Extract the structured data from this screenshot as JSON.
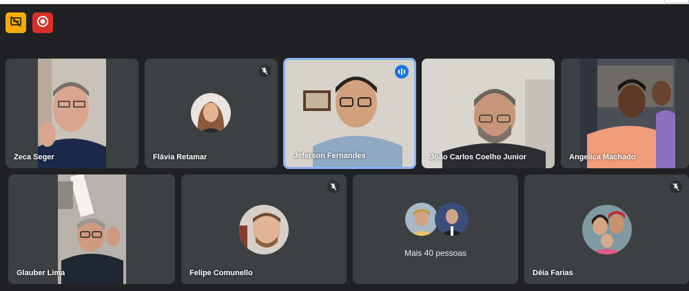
{
  "toolbar": {
    "captions_icon": "captions-off-icon",
    "recording_icon": "recording-icon"
  },
  "participants": {
    "p1": {
      "name": "Zeca Seger"
    },
    "p2": {
      "name": "Flávia Retamar",
      "mic": "muted"
    },
    "p3": {
      "name": "Jeferson Fernandes",
      "status": "speaking"
    },
    "p4": {
      "name": "João Carlos Coelho Junior"
    },
    "p5": {
      "name": "Angelica Machado"
    },
    "p6": {
      "name": "Glauber Lima"
    },
    "p7": {
      "name": "Felipe Comunello",
      "mic": "muted"
    },
    "p8": {
      "label": "Mais 40 pessoas"
    },
    "p9": {
      "name": "Déia Farias",
      "mic": "muted"
    }
  },
  "colors": {
    "background": "#202124",
    "tile": "#3c4043",
    "active_speaker_border": "#8ab4f8",
    "speaking_indicator": "#1a73e8",
    "captions_badge": "#f9ab00",
    "recording_badge": "#d93025"
  }
}
